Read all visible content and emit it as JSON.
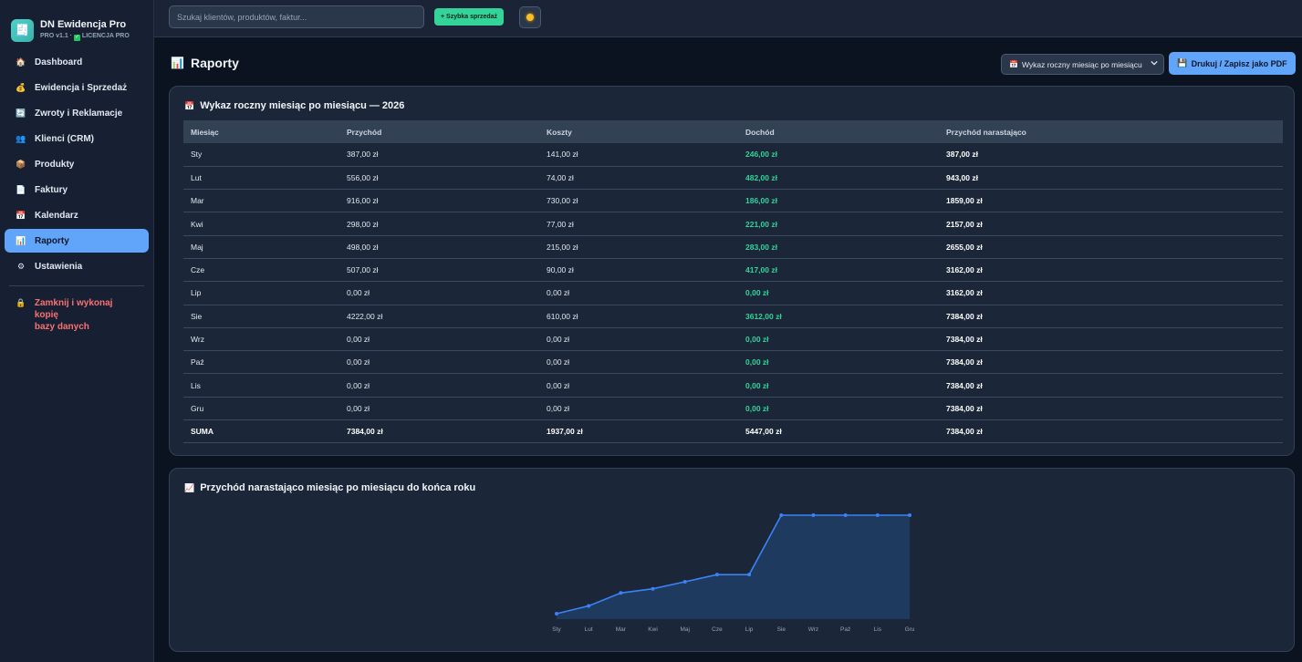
{
  "app": {
    "logo_icon": "🧾",
    "title": "DN Ewidencja Pro",
    "version": "PRO v1.1 ·",
    "license": "LICENCJA PRO"
  },
  "sidebar": {
    "items": [
      {
        "icon": "🏠",
        "label": "Dashboard"
      },
      {
        "icon": "💰",
        "label": "Ewidencja i Sprzedaż"
      },
      {
        "icon": "🔄",
        "label": "Zwroty i Reklamacje"
      },
      {
        "icon": "👥",
        "label": "Klienci (CRM)"
      },
      {
        "icon": "📦",
        "label": "Produkty"
      },
      {
        "icon": "📄",
        "label": "Faktury"
      },
      {
        "icon": "📅",
        "label": "Kalendarz"
      },
      {
        "icon": "📊",
        "label": "Raporty"
      },
      {
        "icon": "⚙",
        "label": "Ustawienia"
      }
    ],
    "exit_icon": "🔒",
    "exit_label_1": "Zamknij i wykonaj kopię",
    "exit_label_2": "bazy danych"
  },
  "topbar": {
    "search_placeholder": "Szukaj klientów, produktów, faktur...",
    "quick_sale": "+ Szybka sprzedaż"
  },
  "page": {
    "icon": "📊",
    "title": "Raporty",
    "select_icon": "📅",
    "select_value": "Wykaz roczny miesiąc po miesiącu",
    "print_icon": "💾",
    "print_label": "Drukuj / Zapisz jako PDF"
  },
  "table_card": {
    "icon": "📅",
    "title": "Wykaz roczny miesiąc po miesiącu — 2026",
    "headers": [
      "Miesiąc",
      "Przychód",
      "Koszty",
      "Dochód",
      "Przychód narastająco"
    ],
    "rows": [
      [
        "Sty",
        "387,00 zł",
        "141,00 zł",
        "246,00 zł",
        "387,00 zł"
      ],
      [
        "Lut",
        "556,00 zł",
        "74,00 zł",
        "482,00 zł",
        "943,00 zł"
      ],
      [
        "Mar",
        "916,00 zł",
        "730,00 zł",
        "186,00 zł",
        "1859,00 zł"
      ],
      [
        "Kwi",
        "298,00 zł",
        "77,00 zł",
        "221,00 zł",
        "2157,00 zł"
      ],
      [
        "Maj",
        "498,00 zł",
        "215,00 zł",
        "283,00 zł",
        "2655,00 zł"
      ],
      [
        "Cze",
        "507,00 zł",
        "90,00 zł",
        "417,00 zł",
        "3162,00 zł"
      ],
      [
        "Lip",
        "0,00 zł",
        "0,00 zł",
        "0,00 zł",
        "3162,00 zł"
      ],
      [
        "Sie",
        "4222,00 zł",
        "610,00 zł",
        "3612,00 zł",
        "7384,00 zł"
      ],
      [
        "Wrz",
        "0,00 zł",
        "0,00 zł",
        "0,00 zł",
        "7384,00 zł"
      ],
      [
        "Paź",
        "0,00 zł",
        "0,00 zł",
        "0,00 zł",
        "7384,00 zł"
      ],
      [
        "Lis",
        "0,00 zł",
        "0,00 zł",
        "0,00 zł",
        "7384,00 zł"
      ],
      [
        "Gru",
        "0,00 zł",
        "0,00 zł",
        "0,00 zł",
        "7384,00 zł"
      ]
    ],
    "sum_row": [
      "SUMA",
      "7384,00 zł",
      "1937,00 zł",
      "5447,00 zł",
      "7384,00 zł"
    ]
  },
  "chart_card": {
    "icon": "📈",
    "title": "Przychód narastająco miesiąc po miesiącu do końca roku"
  },
  "chart_data": {
    "type": "area",
    "title": "Przychód narastająco miesiąc po miesiącu do końca roku",
    "categories": [
      "Sty",
      "Lut",
      "Mar",
      "Kwi",
      "Maj",
      "Cze",
      "Lip",
      "Sie",
      "Wrz",
      "Paź",
      "Lis",
      "Gru"
    ],
    "values": [
      387,
      943,
      1859,
      2157,
      2655,
      3162,
      3162,
      7384,
      7384,
      7384,
      7384,
      7384
    ],
    "ylim": [
      0,
      7384
    ],
    "grid": false,
    "line_color": "#3b82f6",
    "fill_color": "#1e3a5f"
  },
  "colors": {
    "accent": "#60a5fa",
    "success": "#34d399",
    "danger": "#f87171"
  }
}
